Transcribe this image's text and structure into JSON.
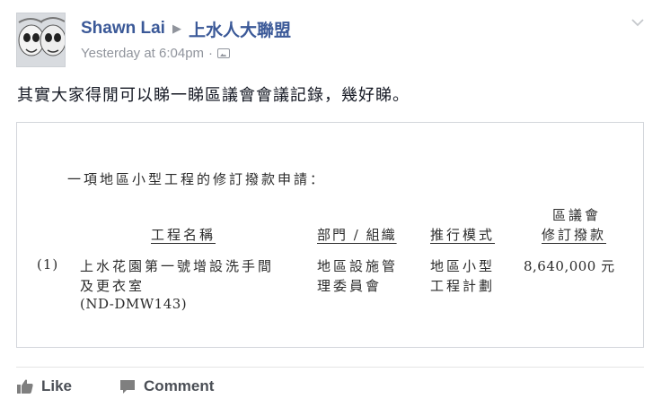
{
  "post": {
    "author": "Shawn Lai",
    "separator_glyph": "▶",
    "group": "上水人大聯盟",
    "timestamp": "Yesterday at 6:04pm",
    "meta_dot": "·",
    "audience_icon": "photo-icon",
    "menu_icon": "chevron-down-icon",
    "message": "其實大家得閒可以睇一睇區議會會議記錄，幾好睇。"
  },
  "document": {
    "heading": "一項地區小型工程的修訂撥款申請：",
    "columns": {
      "project_name": "工程名稱",
      "department": "部門 / 組織",
      "mode": "推行模式",
      "amount_line1": "區議會",
      "amount_line2": "修訂撥款"
    },
    "row": {
      "index": "(1)",
      "project_line1": "上水花園第一號增設洗手間",
      "project_line2": "及更衣室",
      "project_line3": "(ND-DMW143)",
      "dept_line1": "地區設施管",
      "dept_line2": "理委員會",
      "mode_line1": "地區小型",
      "mode_line2": "工程計劃",
      "amount": "8,640,000 元"
    }
  },
  "actions": {
    "like_label": "Like",
    "like_icon": "thumbs-up-icon",
    "comment_label": "Comment",
    "comment_icon": "speech-bubble-icon"
  },
  "colors": {
    "link": "#3b5998",
    "meta": "#90949c",
    "text": "#141823",
    "action": "#4b4f56"
  }
}
